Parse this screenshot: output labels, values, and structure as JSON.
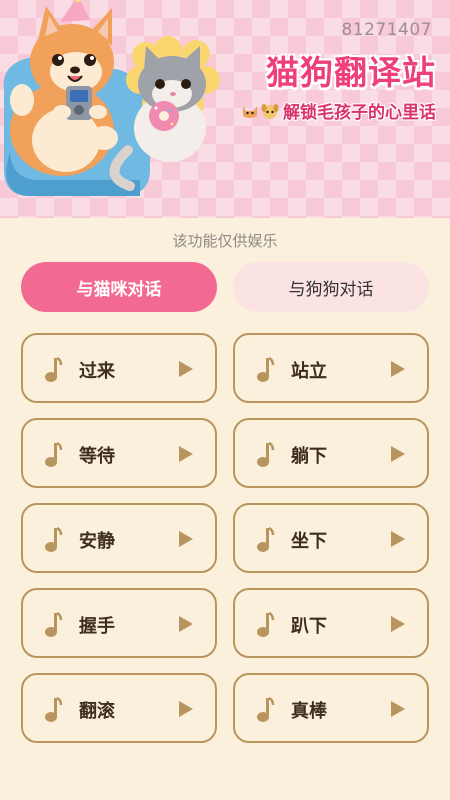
{
  "banner": {
    "user_id": "81271407",
    "title": "猫狗翻译站",
    "subtitle": "解锁毛孩子的心里话",
    "emojis": [
      "cat-face-icon",
      "dog-face-icon"
    ]
  },
  "disclaimer": "该功能仅供娱乐",
  "tabs": [
    {
      "label": "与猫咪对话",
      "active": true
    },
    {
      "label": "与狗狗对话",
      "active": false
    }
  ],
  "commands": [
    {
      "label": "过来"
    },
    {
      "label": "站立"
    },
    {
      "label": "等待"
    },
    {
      "label": "躺下"
    },
    {
      "label": "安静"
    },
    {
      "label": "坐下"
    },
    {
      "label": "握手"
    },
    {
      "label": "趴下"
    },
    {
      "label": "翻滚"
    },
    {
      "label": "真棒"
    }
  ],
  "colors": {
    "background": "#FBF0DB",
    "accent_pink": "#F26A92",
    "title_pink": "#EE3F7A",
    "card_border": "#B8945E",
    "icon_brown": "#B8945E"
  }
}
